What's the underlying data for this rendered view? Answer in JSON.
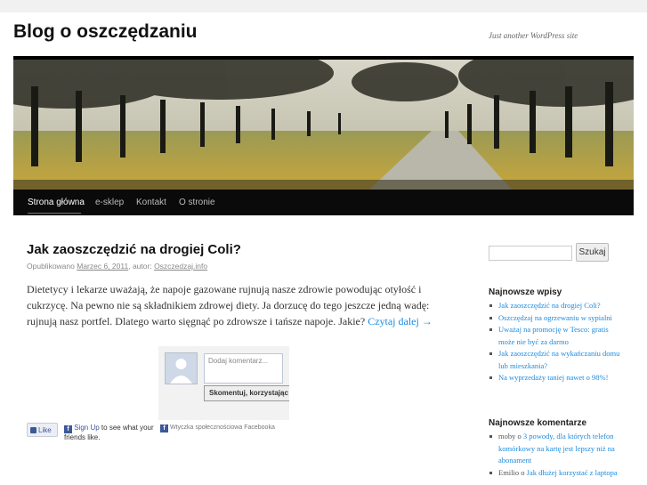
{
  "site": {
    "title": "Blog o oszczędzaniu",
    "tagline": "Just another WordPress site"
  },
  "nav": {
    "items": [
      {
        "label": "Strona główna"
      },
      {
        "label": "e-sklep"
      },
      {
        "label": "Kontakt"
      },
      {
        "label": "O stronie"
      }
    ]
  },
  "post": {
    "title": "Jak zaoszczędzić na drogiej Coli?",
    "meta_prefix": "Opublikowano",
    "date": "Marzec 6, 2011",
    "meta_author_prefix": ", autor:",
    "author": "Oszczedzaj.info",
    "excerpt": "Dietetycy i lekarze uważają, że napoje gazowane rujnują nasze zdrowie powodując otyłość i cukrzycę. Na pewno nie są składnikiem zdrowej diety. Ja dorzucę do tego jeszcze jedną wadę: rujnują nasz portfel. Dlatego warto sięgnąć po zdrowsze i tańsze napoje. Jakie?",
    "read_more": "Czytaj dalej →"
  },
  "facebook": {
    "like_label": "Like",
    "signup_link": "Sign Up",
    "signup_text": " to see what your friends like.",
    "comment_placeholder": "Dodaj komentarz...",
    "submit_label": "Skomentuj, korzystając z...",
    "plugin_label": "Wtyczka społecznościowa Facebooka"
  },
  "sidebar": {
    "search_button": "Szukaj",
    "search_value": "",
    "recent_posts_title": "Najnowsze wpisy",
    "recent_posts": [
      "Jak zaoszczędzić na drogiej Coli?",
      "Oszczędzaj na ogrzewaniu w sypialni",
      "Uważaj na promocję w Tesco: gratis może nie być za darmo",
      "Jak zaoszczędzić na wykańczaniu domu lub mieszkania?",
      "Na wyprzedaży taniej nawet o 98%!"
    ],
    "recent_comments_title": "Najnowsze komentarze",
    "recent_comments": [
      {
        "author": "moby",
        "sep": " o ",
        "post": "3 powody, dla których telefon komórkowy na kartę jest lepszy niż na abonament"
      },
      {
        "author": "Emilio",
        "sep": " o ",
        "post": "Jak dłużej korzystać z laptopa"
      }
    ]
  },
  "colors": {
    "nav_bg": "#0a0a0a",
    "link": "#1b8be0",
    "facebook_blue": "#3b5998"
  }
}
